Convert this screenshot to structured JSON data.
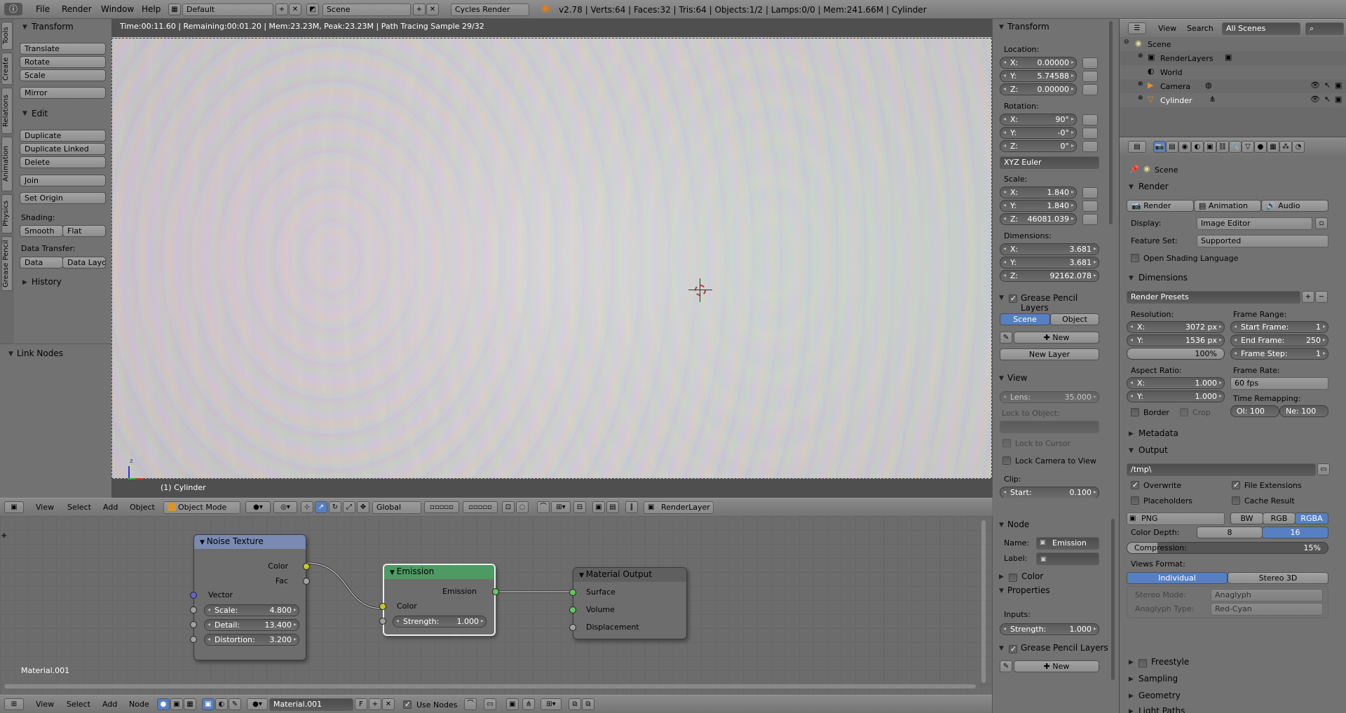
{
  "topbar": {
    "menus": [
      "File",
      "Render",
      "Window",
      "Help"
    ],
    "layout": "Default",
    "scene": "Scene",
    "engine": "Cycles Render",
    "stats": "v2.78 | Verts:64 | Faces:32 | Tris:64 | Objects:1/2 | Lamps:0/0 | Mem:241.66M | Cylinder"
  },
  "viewport": {
    "status": "Time:00:11.60 | Remaining:00:01.20 | Mem:23.23M, Peak:23.23M | Path Tracing Sample 29/32",
    "object_label": "(1) Cylinder",
    "header": {
      "menus": [
        "View",
        "Select",
        "Add",
        "Object"
      ],
      "mode": "Object Mode",
      "orientation": "Global",
      "render_layer": "RenderLayer"
    }
  },
  "vtabs": [
    "Tools",
    "Create",
    "Relations",
    "Animation",
    "Physics",
    "Grease Pencil"
  ],
  "toolshelf": {
    "transform_title": "Transform",
    "transform": [
      "Translate",
      "Rotate",
      "Scale"
    ],
    "mirror": "Mirror",
    "edit_title": "Edit",
    "edit": [
      "Duplicate",
      "Duplicate Linked",
      "Delete"
    ],
    "join": "Join",
    "set_origin": "Set Origin",
    "shading_label": "Shading:",
    "smooth": "Smooth",
    "flat": "Flat",
    "data_transfer_label": "Data Transfer:",
    "data": "Data",
    "data_layo": "Data Layo",
    "history": "History",
    "link_nodes": "Link Nodes"
  },
  "npanel": {
    "transform_title": "Transform",
    "location_label": "Location:",
    "location": [
      {
        "a": "X:",
        "v": "0.00000"
      },
      {
        "a": "Y:",
        "v": "5.74588"
      },
      {
        "a": "Z:",
        "v": "0.00000"
      }
    ],
    "rotation_label": "Rotation:",
    "rotation": [
      {
        "a": "X:",
        "v": "90°"
      },
      {
        "a": "Y:",
        "v": "-0°"
      },
      {
        "a": "Z:",
        "v": "0°"
      }
    ],
    "rotation_mode": "XYZ Euler",
    "scale_label": "Scale:",
    "scale": [
      {
        "a": "X:",
        "v": "1.840"
      },
      {
        "a": "Y:",
        "v": "1.840"
      },
      {
        "a": "Z:",
        "v": "46081.039"
      }
    ],
    "dimensions_label": "Dimensions:",
    "dimensions": [
      {
        "a": "X:",
        "v": "3.681"
      },
      {
        "a": "Y:",
        "v": "3.681"
      },
      {
        "a": "Z:",
        "v": "92162.078"
      }
    ],
    "gp_layers_title": "Grease Pencil Layers",
    "gp_scene": "Scene",
    "gp_object": "Object",
    "gp_new": "New",
    "gp_new_layer": "New Layer",
    "view_title": "View",
    "lens_label": "Lens:",
    "lens_value": "35.000",
    "lock_to_object": "Lock to Object:",
    "lock_to_cursor": "Lock to Cursor",
    "lock_camera": "Lock Camera to View",
    "clip_label": "Clip:",
    "clip_start_label": "Start:",
    "clip_start_value": "0.100"
  },
  "outliner": {
    "menus": [
      "View",
      "Search"
    ],
    "scope": "All Scenes",
    "items": [
      {
        "label": "Scene"
      },
      {
        "label": "RenderLayers"
      },
      {
        "label": "World"
      },
      {
        "label": "Camera"
      },
      {
        "label": "Cylinder"
      }
    ]
  },
  "properties": {
    "context": "Scene",
    "render_title": "Render",
    "render_btn": "Render",
    "animation_btn": "Animation",
    "audio_btn": "Audio",
    "display_label": "Display:",
    "display_value": "Image Editor",
    "feature_label": "Feature Set:",
    "feature_value": "Supported",
    "osl": "Open Shading Language",
    "dimensions_title": "Dimensions",
    "render_presets": "Render Presets",
    "resolution_label": "Resolution:",
    "res_x": {
      "a": "X:",
      "v": "3072 px"
    },
    "res_y": {
      "a": "Y:",
      "v": "1536 px"
    },
    "res_pct": "100%",
    "frame_range_label": "Frame Range:",
    "start_frame": {
      "a": "Start Frame:",
      "v": "1"
    },
    "end_frame": {
      "a": "End Frame:",
      "v": "250"
    },
    "frame_step": {
      "a": "Frame Step:",
      "v": "1"
    },
    "aspect_label": "Aspect Ratio:",
    "asp_x": {
      "a": "X:",
      "v": "1.000"
    },
    "asp_y": {
      "a": "Y:",
      "v": "1.000"
    },
    "frame_rate_label": "Frame Rate:",
    "frame_rate": "60 fps",
    "time_remap_label": "Time Remapping:",
    "remap_old": "Ol: 100",
    "remap_new": "Ne: 100",
    "border": "Border",
    "crop": "Crop",
    "metadata_title": "Metadata",
    "output_title": "Output",
    "output_path": "/tmp\\",
    "overwrite": "Overwrite",
    "file_ext": "File Extensions",
    "placeholders": "Placeholders",
    "cache_result": "Cache Result",
    "format": "PNG",
    "bw": "BW",
    "rgb": "RGB",
    "rgba": "RGBA",
    "color_depth_label": "Color Depth:",
    "depth_8": "8",
    "depth_16": "16",
    "compression_label": "Compression:",
    "compression_value": "15%",
    "compression_fraction": 0.15,
    "views_format_label": "Views Format:",
    "individual": "Individual",
    "stereo3d": "Stereo 3D",
    "stereo_mode_label": "Stereo Mode:",
    "stereo_mode": "Anaglyph",
    "anaglyph_label": "Anaglyph Type:",
    "anaglyph": "Red-Cyan",
    "freestyle": "Freestyle",
    "sampling": "Sampling",
    "geometry": "Geometry",
    "light_paths": "Light Paths"
  },
  "nodeeditor": {
    "material_label": "Material.001",
    "noise": {
      "title": "Noise Texture",
      "out_color": "Color",
      "out_fac": "Fac",
      "vector": "Vector",
      "scale": {
        "a": "Scale:",
        "v": "4.800"
      },
      "detail": {
        "a": "Detail:",
        "v": "13.400"
      },
      "distortion": {
        "a": "Distortion:",
        "v": "3.200"
      }
    },
    "emission": {
      "title": "Emission",
      "out": "Emission",
      "color": "Color",
      "strength": {
        "a": "Strength:",
        "v": "1.000"
      }
    },
    "output": {
      "title": "Material Output",
      "surface": "Surface",
      "volume": "Volume",
      "displacement": "Displacement"
    },
    "header": {
      "menus": [
        "View",
        "Select",
        "Add",
        "Node"
      ],
      "material": "Material.001",
      "fake": "F",
      "use_nodes": "Use Nodes"
    }
  },
  "nodepanel": {
    "node_title": "Node",
    "name_label": "Name:",
    "name_value": "Emission",
    "label_label": "Label:",
    "color_title": "Color",
    "properties_title": "Properties",
    "inputs_label": "Inputs:",
    "strength": {
      "a": "Strength:",
      "v": "1.000"
    },
    "gp_title": "Grease Pencil Layers",
    "gp_new": "New"
  }
}
